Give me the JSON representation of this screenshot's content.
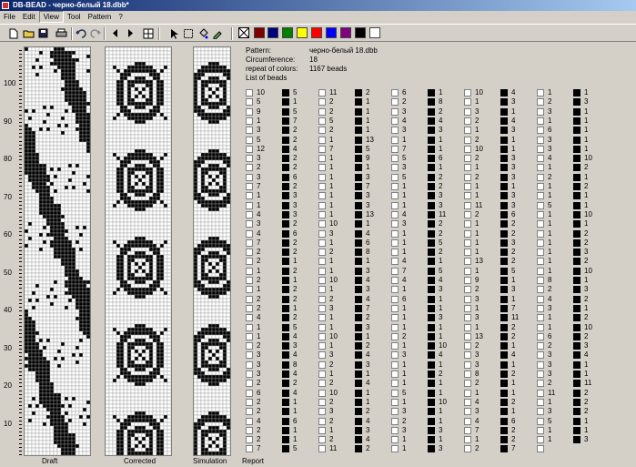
{
  "window": {
    "title": "DB-BEAD - черно-белый 18.dbb*"
  },
  "menu": [
    "File",
    "Edit",
    "View",
    "Tool",
    "Pattern",
    "?"
  ],
  "toolbar": {
    "palette": [
      "#ffffff",
      "#800000",
      "#000080",
      "#008000",
      "#ffff00",
      "#ff0000",
      "#0000ff",
      "#800080",
      "#000000",
      "#ffffff"
    ]
  },
  "ruler": {
    "labels": [
      "100",
      "90",
      "80",
      "70",
      "60",
      "50",
      "40",
      "30",
      "20",
      "10"
    ]
  },
  "panels": {
    "draft": "Draft",
    "corrected": "Corrected",
    "simulation": "Simulation",
    "report": "Report"
  },
  "report": {
    "pattern_label": "Pattern:",
    "pattern_value": "черно-белый 18.dbb",
    "circumference_label": "Circumference:",
    "circumference_value": "18",
    "repeat_label": "repeat of colors:",
    "repeat_value": "1167 beads",
    "list_label": "List of beads",
    "beads": [
      [
        "w10",
        "b5",
        "w11",
        "b2",
        "w6",
        "b1",
        "w10",
        "b4",
        "w1",
        "b1"
      ],
      [
        "w5",
        "b1",
        "w2",
        "b1",
        "w2",
        "b8",
        "w1",
        "b3",
        "w2",
        "b3"
      ],
      [
        "w9",
        "b5",
        "w2",
        "b1",
        "w3",
        "b2",
        "w3",
        "b1",
        "w3",
        "b1"
      ],
      [
        "w1",
        "b7",
        "w5",
        "b1",
        "w4",
        "b4",
        "w2",
        "b4",
        "w1",
        "b1"
      ],
      [
        "w3",
        "b2",
        "w2",
        "b1",
        "w3",
        "b3",
        "w1",
        "b3",
        "w6",
        "b1"
      ],
      [
        "w5",
        "b2",
        "w1",
        "b13",
        "w1",
        "b1",
        "w2",
        "b1",
        "w3",
        "b1"
      ],
      [
        "w12",
        "b4",
        "w7",
        "b5",
        "w7",
        "b1",
        "w10",
        "b1",
        "w3",
        "b1"
      ],
      [
        "w3",
        "b2",
        "w1",
        "b9",
        "w5",
        "b6",
        "w2",
        "b3",
        "w4",
        "b10"
      ],
      [
        "w2",
        "b2",
        "w1",
        "b1",
        "w3",
        "b1",
        "w1",
        "b3",
        "w1",
        "b2"
      ],
      [
        "w3",
        "b6",
        "w1",
        "b3",
        "w5",
        "b2",
        "w2",
        "b3",
        "w2",
        "b1"
      ],
      [
        "w7",
        "b2",
        "w1",
        "b7",
        "w1",
        "b2",
        "w1",
        "b1",
        "w1",
        "b2"
      ],
      [
        "w1",
        "b3",
        "w1",
        "b3",
        "w1",
        "b3",
        "w1",
        "b3",
        "w1",
        "b1"
      ],
      [
        "w1",
        "b3",
        "w1",
        "b3",
        "w1",
        "b3",
        "w11",
        "b3",
        "w5",
        "b1"
      ],
      [
        "w4",
        "b3",
        "w1",
        "b13",
        "w4",
        "b11",
        "w2",
        "b6",
        "w1",
        "b10"
      ],
      [
        "w3",
        "b2",
        "w10",
        "b1",
        "w3",
        "b2",
        "w1",
        "b2",
        "w1",
        "b1"
      ],
      [
        "w4",
        "b6",
        "w3",
        "b4",
        "w1",
        "b2",
        "w1",
        "b2",
        "w1",
        "b2"
      ],
      [
        "w7",
        "b2",
        "w1",
        "b6",
        "w1",
        "b5",
        "w1",
        "b3",
        "w1",
        "b2"
      ],
      [
        "w2",
        "b2",
        "w2",
        "b8",
        "w1",
        "b2",
        "w1",
        "b2",
        "w1",
        "b3"
      ],
      [
        "w2",
        "b1",
        "w1",
        "b1",
        "w4",
        "b1",
        "w13",
        "b2",
        "w1",
        "b2"
      ],
      [
        "w1",
        "b2",
        "w1",
        "b3",
        "w7",
        "b5",
        "w1",
        "b5",
        "w1",
        "b10"
      ],
      [
        "w2",
        "b1",
        "w10",
        "b4",
        "w4",
        "b4",
        "w9",
        "b1",
        "w8",
        "b1"
      ],
      [
        "w1",
        "b2",
        "w1",
        "b3",
        "w1",
        "b3",
        "w2",
        "b3",
        "w2",
        "b3"
      ],
      [
        "w2",
        "b2",
        "w2",
        "b4",
        "w6",
        "b1",
        "w3",
        "b1",
        "w4",
        "b2"
      ],
      [
        "w2",
        "b1",
        "w3",
        "b7",
        "w1",
        "b1",
        "w1",
        "b7",
        "w3",
        "b1"
      ],
      [
        "w4",
        "b2",
        "w1",
        "b2",
        "w1",
        "b3",
        "w3",
        "b11",
        "w1",
        "b2"
      ],
      [
        "w1",
        "b5",
        "w1",
        "b3",
        "w1",
        "b1",
        "w1",
        "b2",
        "w1",
        "b10"
      ],
      [
        "w1",
        "b4",
        "w10",
        "b1",
        "w2",
        "b1",
        "w13",
        "b2",
        "w6",
        "b2"
      ],
      [
        "w2",
        "b3",
        "w1",
        "b2",
        "w1",
        "b10",
        "w2",
        "b1",
        "w2",
        "b3"
      ],
      [
        "w3",
        "b4",
        "w3",
        "b4",
        "w3",
        "b4",
        "w3",
        "b4",
        "w3",
        "b4"
      ],
      [
        "w3",
        "b8",
        "w2",
        "b3",
        "w1",
        "b1",
        "w3",
        "b1",
        "w3",
        "b1"
      ],
      [
        "w3",
        "b4",
        "w1",
        "b1",
        "w1",
        "b2",
        "w8",
        "b2",
        "w3",
        "b1"
      ],
      [
        "w2",
        "b2",
        "w2",
        "b4",
        "w1",
        "b1",
        "w2",
        "b1",
        "w2",
        "b11"
      ],
      [
        "w6",
        "b4",
        "w10",
        "b1",
        "w5",
        "b1",
        "w1",
        "b1",
        "w11",
        "b2"
      ],
      [
        "w2",
        "b1",
        "w2",
        "b1",
        "w1",
        "b10",
        "w4",
        "b2",
        "w1",
        "b2"
      ],
      [
        "w2",
        "b1",
        "w3",
        "b2",
        "w3",
        "b1",
        "w3",
        "b1",
        "w3",
        "b2"
      ],
      [
        "w4",
        "b6",
        "w2",
        "b4",
        "w2",
        "b1",
        "w4",
        "b6",
        "w5",
        "b1"
      ],
      [
        "w2",
        "b1",
        "w1",
        "b3",
        "w3",
        "b3",
        "w7",
        "b2",
        "w1",
        "b1"
      ],
      [
        "w2",
        "b1",
        "w2",
        "b4",
        "w1",
        "b1",
        "w1",
        "b2",
        "w1",
        "b3"
      ],
      [
        "w7",
        "b5",
        "w11",
        "b2",
        "w1",
        "b3",
        "w2",
        "b7",
        "w",
        ""
      ]
    ]
  }
}
